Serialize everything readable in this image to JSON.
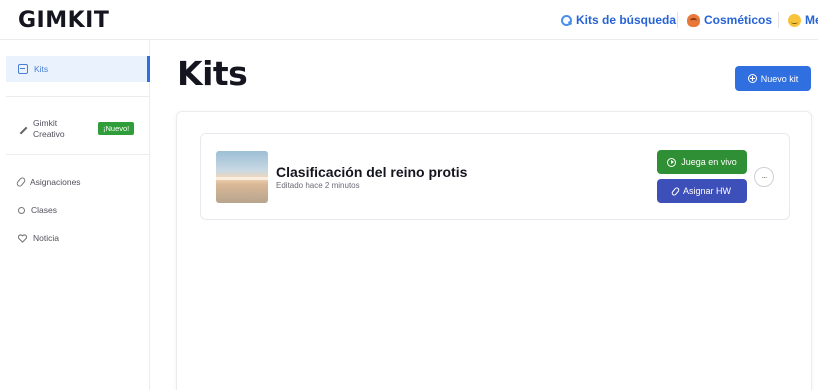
{
  "header": {
    "logo": "GIMKIT",
    "nav": [
      {
        "label": "Kits de búsqueda",
        "icon": "search-icon"
      },
      {
        "label": "Cosméticos",
        "icon": "cosmetics-icon"
      },
      {
        "label": "Me",
        "icon": "smiley-icon"
      }
    ]
  },
  "sidebar": {
    "items": [
      {
        "label": "Kits",
        "icon": "kits-icon",
        "active": true
      },
      {
        "label": "Gimkit Creativo",
        "icon": "wrench-icon",
        "badge": "¡Nuevo!"
      },
      {
        "label": "Asignaciones",
        "icon": "paperclip-icon"
      },
      {
        "label": "Clases",
        "icon": "people-icon"
      },
      {
        "label": "Noticia",
        "icon": "heart-icon"
      }
    ]
  },
  "main": {
    "title": "Kits",
    "new_kit_label": "Nuevo kit",
    "kits": [
      {
        "title": "Clasificación del reino protis",
        "subtitle": "Editado hace 2 minutos",
        "live_label": "Juega en vivo",
        "assign_label": "Asignar HW",
        "more_label": "···"
      }
    ]
  },
  "colors": {
    "primary": "#2f6fe0",
    "live_green": "#2f8f35",
    "assign_indigo": "#3d4fb8",
    "badge_green": "#2f9e3a",
    "active_bg": "#eaf2fd"
  }
}
